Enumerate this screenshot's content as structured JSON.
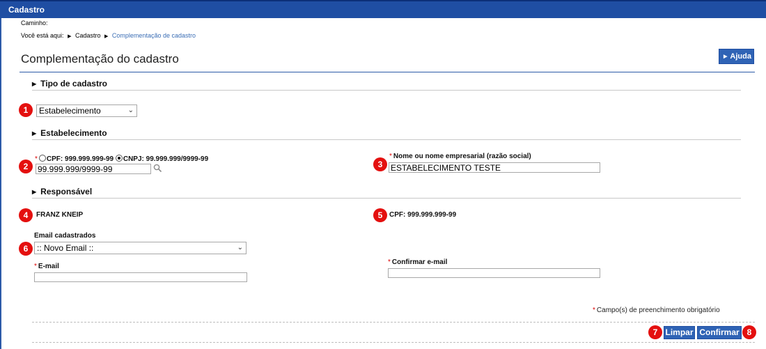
{
  "window": {
    "title": "Cadastro"
  },
  "path": {
    "label": "Caminho:"
  },
  "breadcrumb": {
    "prefix": "Você está aqui:",
    "items": [
      "Cadastro",
      "Complementação de cadastro"
    ]
  },
  "page": {
    "title": "Complementação do cadastro",
    "help_label": "Ajuda"
  },
  "sections": {
    "tipo": {
      "title": "Tipo de cadastro",
      "select_value": "Estabelecimento"
    },
    "estabelecimento": {
      "title": "Estabelecimento",
      "cpf_option": "CPF: 999.999.999-99",
      "cnpj_option": "CNPJ: 99.999.999/9999-99",
      "doc_value": "99.999.999/9999-99",
      "name_label": "Nome ou nome empresarial (razão social)",
      "name_value": "ESTABELECIMENTO TESTE"
    },
    "responsavel": {
      "title": "Responsável",
      "name": "FRANZ KNEIP",
      "cpf": "CPF: 999.999.999-99",
      "email_list_label": "Email cadastrados",
      "email_list_value": ":: Novo Email ::",
      "email_label": "E-mail",
      "email_value": "",
      "confirm_label": "Confirmar e-mail",
      "confirm_value": ""
    }
  },
  "required": {
    "marker": "*",
    "note": "Campo(s) de preenchimento obrigatório"
  },
  "actions": {
    "clear_label": "Limpar",
    "confirm_label": "Confirmar"
  },
  "badges": [
    "1",
    "2",
    "3",
    "4",
    "5",
    "6",
    "7",
    "8"
  ],
  "icons": {
    "section_arrow": "triangle-right-icon",
    "lookup": "magnifier-icon",
    "dropdown": "chevron-down-icon"
  },
  "colors": {
    "header": "#1f4ea3",
    "button": "#2f63b5",
    "badge": "#e4100f",
    "required": "#dd0000",
    "breadcrumb_current": "#3b6eb5"
  }
}
